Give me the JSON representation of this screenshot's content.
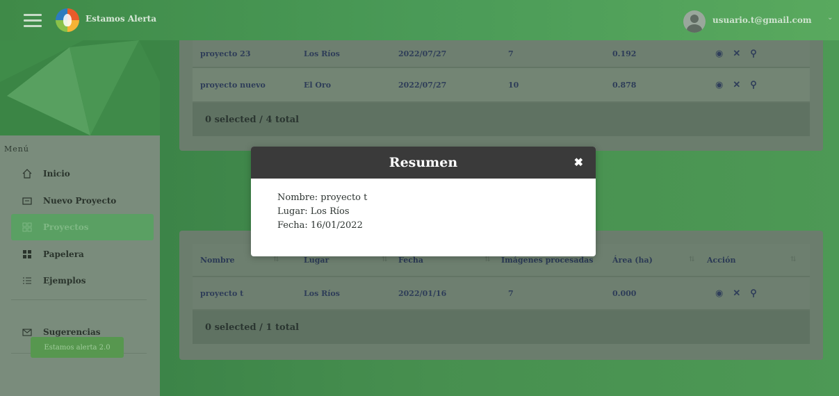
{
  "header": {
    "app_title": "Estamos Alerta",
    "user_email": "usuario.t@gmail.com"
  },
  "sidebar": {
    "heading": "Menú",
    "items": [
      {
        "label": "Inicio",
        "icon": "home-icon"
      },
      {
        "label": "Nuevo Proyecto",
        "icon": "folder-icon"
      },
      {
        "label": "Proyectos",
        "icon": "grid-icon",
        "active": true
      },
      {
        "label": "Papelera",
        "icon": "trash-grid-icon"
      },
      {
        "label": "Ejemplos",
        "icon": "list-icon"
      },
      {
        "label": "Sugerencias",
        "icon": "mail-icon"
      }
    ],
    "footer_button": "Estamos alerta 2.0"
  },
  "table1": {
    "rows": [
      {
        "nombre": "proyecto 23",
        "lugar": "Los Ríos",
        "fecha": "2022/07/27",
        "imagenes": "7",
        "area": "0.192"
      },
      {
        "nombre": "proyecto nuevo",
        "lugar": "El Oro",
        "fecha": "2022/07/27",
        "imagenes": "10",
        "area": "0.878"
      }
    ],
    "summary": "0 selected / 4 total"
  },
  "table2": {
    "headers": {
      "nombre": "Nombre",
      "lugar": "Lugar",
      "fecha": "Fecha",
      "imagenes": "Imágenes procesadas",
      "area": "Área (ha)",
      "accion": "Acción"
    },
    "rows": [
      {
        "nombre": "proyecto t",
        "lugar": "Los Ríos",
        "fecha": "2022/01/16",
        "imagenes": "7",
        "area": "0.000"
      }
    ],
    "summary": "0 selected / 1 total"
  },
  "modal": {
    "title": "Resumen",
    "close": "✖",
    "lines": [
      "Nombre: proyecto t",
      "Lugar: Los Ríos",
      "Fecha: 16/01/2022"
    ]
  },
  "icons": {
    "view": "eye-icon",
    "delete": "x-icon",
    "tag": "signpost-icon"
  }
}
